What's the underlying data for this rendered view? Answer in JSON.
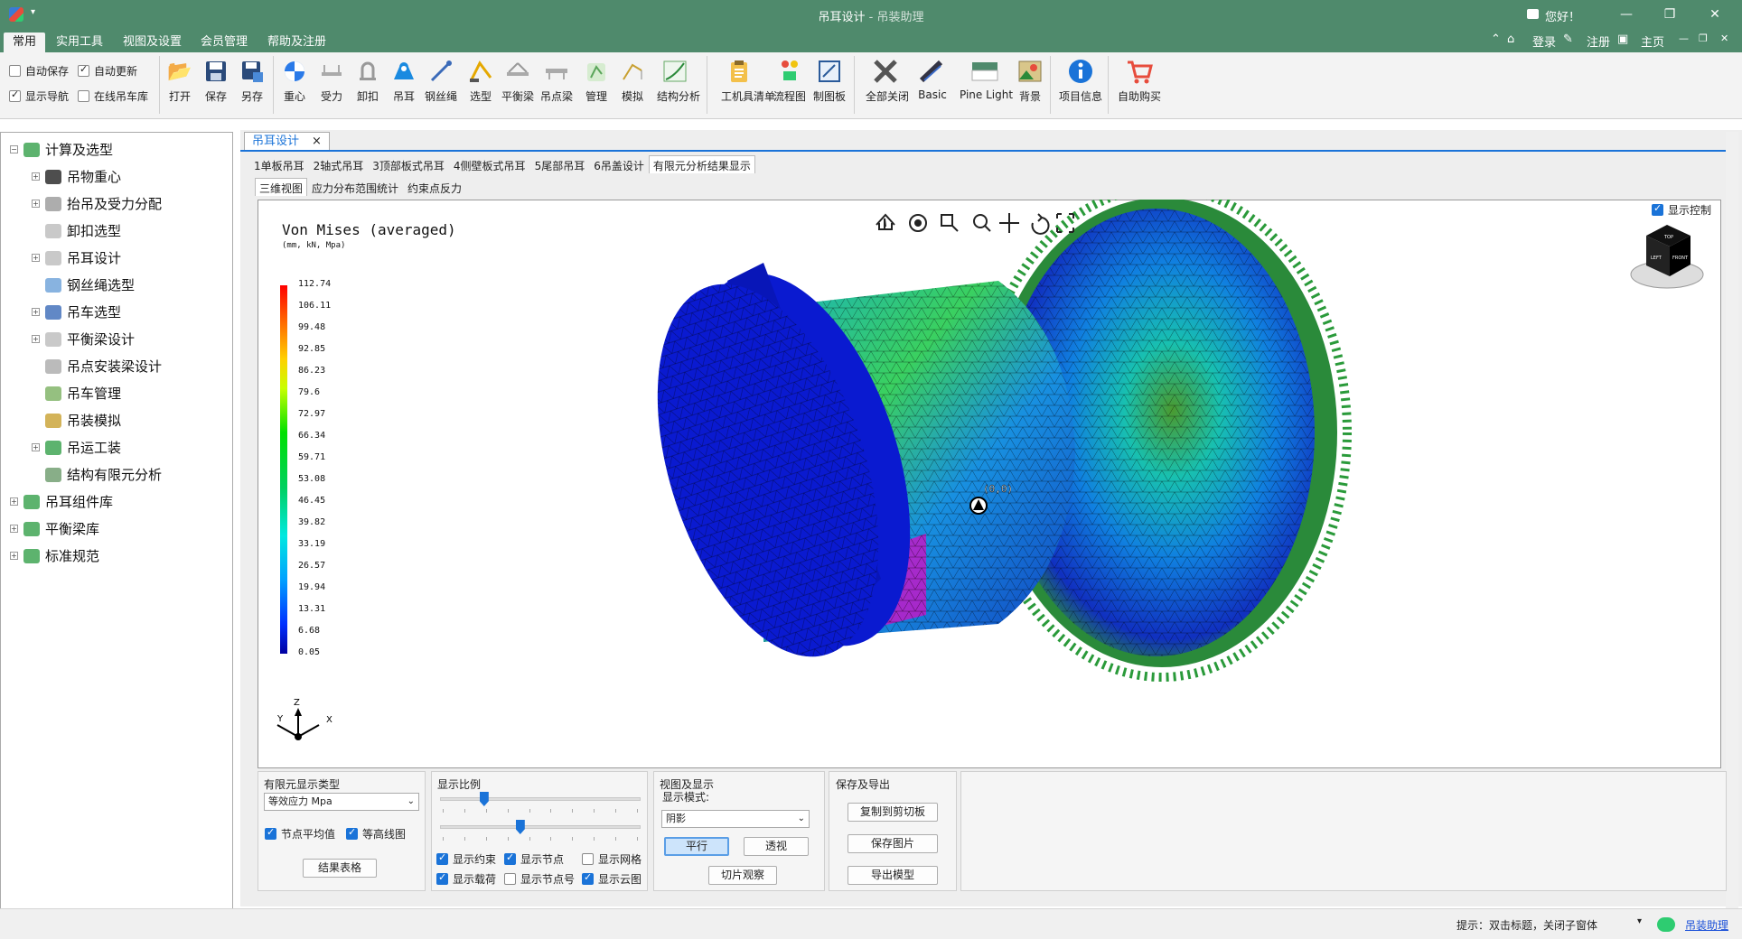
{
  "window": {
    "title": "吊耳设计",
    "subtitle": " - 吊装助理",
    "greeting": "您好！",
    "min": "—",
    "max": "❐",
    "close": "✕"
  },
  "menu": {
    "tabs": [
      "常用",
      "实用工具",
      "视图及设置",
      "会员管理",
      "帮助及注册"
    ],
    "right": {
      "login": "登录",
      "register": "注册",
      "home": "主页"
    }
  },
  "ribbon": {
    "checks": {
      "auto_save": "自动保存",
      "auto_update": "自动更新",
      "show_nav": "显示导航",
      "online_lib": "在线吊车库"
    },
    "buttons": [
      "打开",
      "保存",
      "另存",
      "重心",
      "受力",
      "卸扣",
      "吊耳",
      "钢丝绳",
      "选型",
      "平衡梁",
      "吊点梁",
      "管理",
      "模拟",
      "结构分析",
      "工机具清单",
      "流程图",
      "制图板",
      "全部关闭",
      "Basic",
      "Pine Light",
      "背景",
      "项目信息",
      "自助购买"
    ]
  },
  "tree": {
    "items": [
      {
        "label": "计算及选型",
        "level": 0,
        "exp": "−"
      },
      {
        "label": "吊物重心",
        "level": 1,
        "exp": "+"
      },
      {
        "label": "抬吊及受力分配",
        "level": 1,
        "exp": "+"
      },
      {
        "label": "卸扣选型",
        "level": 1,
        "exp": ""
      },
      {
        "label": "吊耳设计",
        "level": 1,
        "exp": "+"
      },
      {
        "label": "钢丝绳选型",
        "level": 1,
        "exp": ""
      },
      {
        "label": "吊车选型",
        "level": 1,
        "exp": "+"
      },
      {
        "label": "平衡梁设计",
        "level": 1,
        "exp": "+"
      },
      {
        "label": "吊点安装梁设计",
        "level": 1,
        "exp": ""
      },
      {
        "label": "吊车管理",
        "level": 1,
        "exp": ""
      },
      {
        "label": "吊装模拟",
        "level": 1,
        "exp": ""
      },
      {
        "label": "吊运工装",
        "level": 1,
        "exp": "+"
      },
      {
        "label": "结构有限元分析",
        "level": 1,
        "exp": ""
      },
      {
        "label": "吊耳组件库",
        "level": 0,
        "exp": "+"
      },
      {
        "label": "平衡梁库",
        "level": 0,
        "exp": "+"
      },
      {
        "label": "标准规范",
        "level": 0,
        "exp": "+"
      }
    ]
  },
  "doc": {
    "tab": "吊耳设计",
    "tab_close": "×",
    "subtabs": [
      "1单板吊耳",
      "2轴式吊耳",
      "3顶部板式吊耳",
      "4侧壁板式吊耳",
      "5尾部吊耳",
      "6吊盖设计",
      "有限元分析结果显示"
    ],
    "viewtabs": [
      "三维视图",
      "应力分布范围统计",
      "约束点反力"
    ]
  },
  "viewport": {
    "legend_title": "Von Mises (averaged)",
    "units": "(mm, kN, Mpa)",
    "scale_values": [
      "112.74",
      "106.11",
      "99.48",
      "92.85",
      "86.23",
      "79.6",
      "72.97",
      "66.34",
      "59.71",
      "53.08",
      "46.45",
      "39.82",
      "33.19",
      "26.57",
      "19.94",
      "13.31",
      "6.68",
      "0.05"
    ],
    "show_control": "显示控制",
    "origin_label": "(0,0)",
    "axes": {
      "z": "Z",
      "y": "Y",
      "x": "X"
    },
    "cube_labels": {
      "top": "TOP",
      "left": "LEFT",
      "front": "FRONT"
    }
  },
  "panels": {
    "fe_type": {
      "title": "有限元显示类型",
      "combo_value": "等效应力 Mpa",
      "node_avg": "节点平均值",
      "contour": "等高线图",
      "result_table": "结果表格"
    },
    "scale": {
      "title": "显示比例",
      "slider1": 0.22,
      "slider2": 0.4,
      "checks": [
        "显示约束",
        "显示节点",
        "显示网格",
        "显示载荷",
        "显示节点号",
        "显示云图"
      ]
    },
    "view": {
      "title": "视图及显示",
      "mode_label": "显示模式:",
      "mode_value": "阴影",
      "parallel": "平行",
      "perspective": "透视",
      "slice": "切片观察"
    },
    "export": {
      "title": "保存及导出",
      "copy": "复制到剪切板",
      "save_img": "保存图片",
      "export_model": "导出模型"
    }
  },
  "status": {
    "hint": "提示：双击标题，关闭子窗体",
    "link": "吊装助理"
  },
  "colors": {
    "title_bar": "#4f8a6c",
    "accent": "#1a73d8",
    "mesh_blue": "#0a1ad0"
  }
}
